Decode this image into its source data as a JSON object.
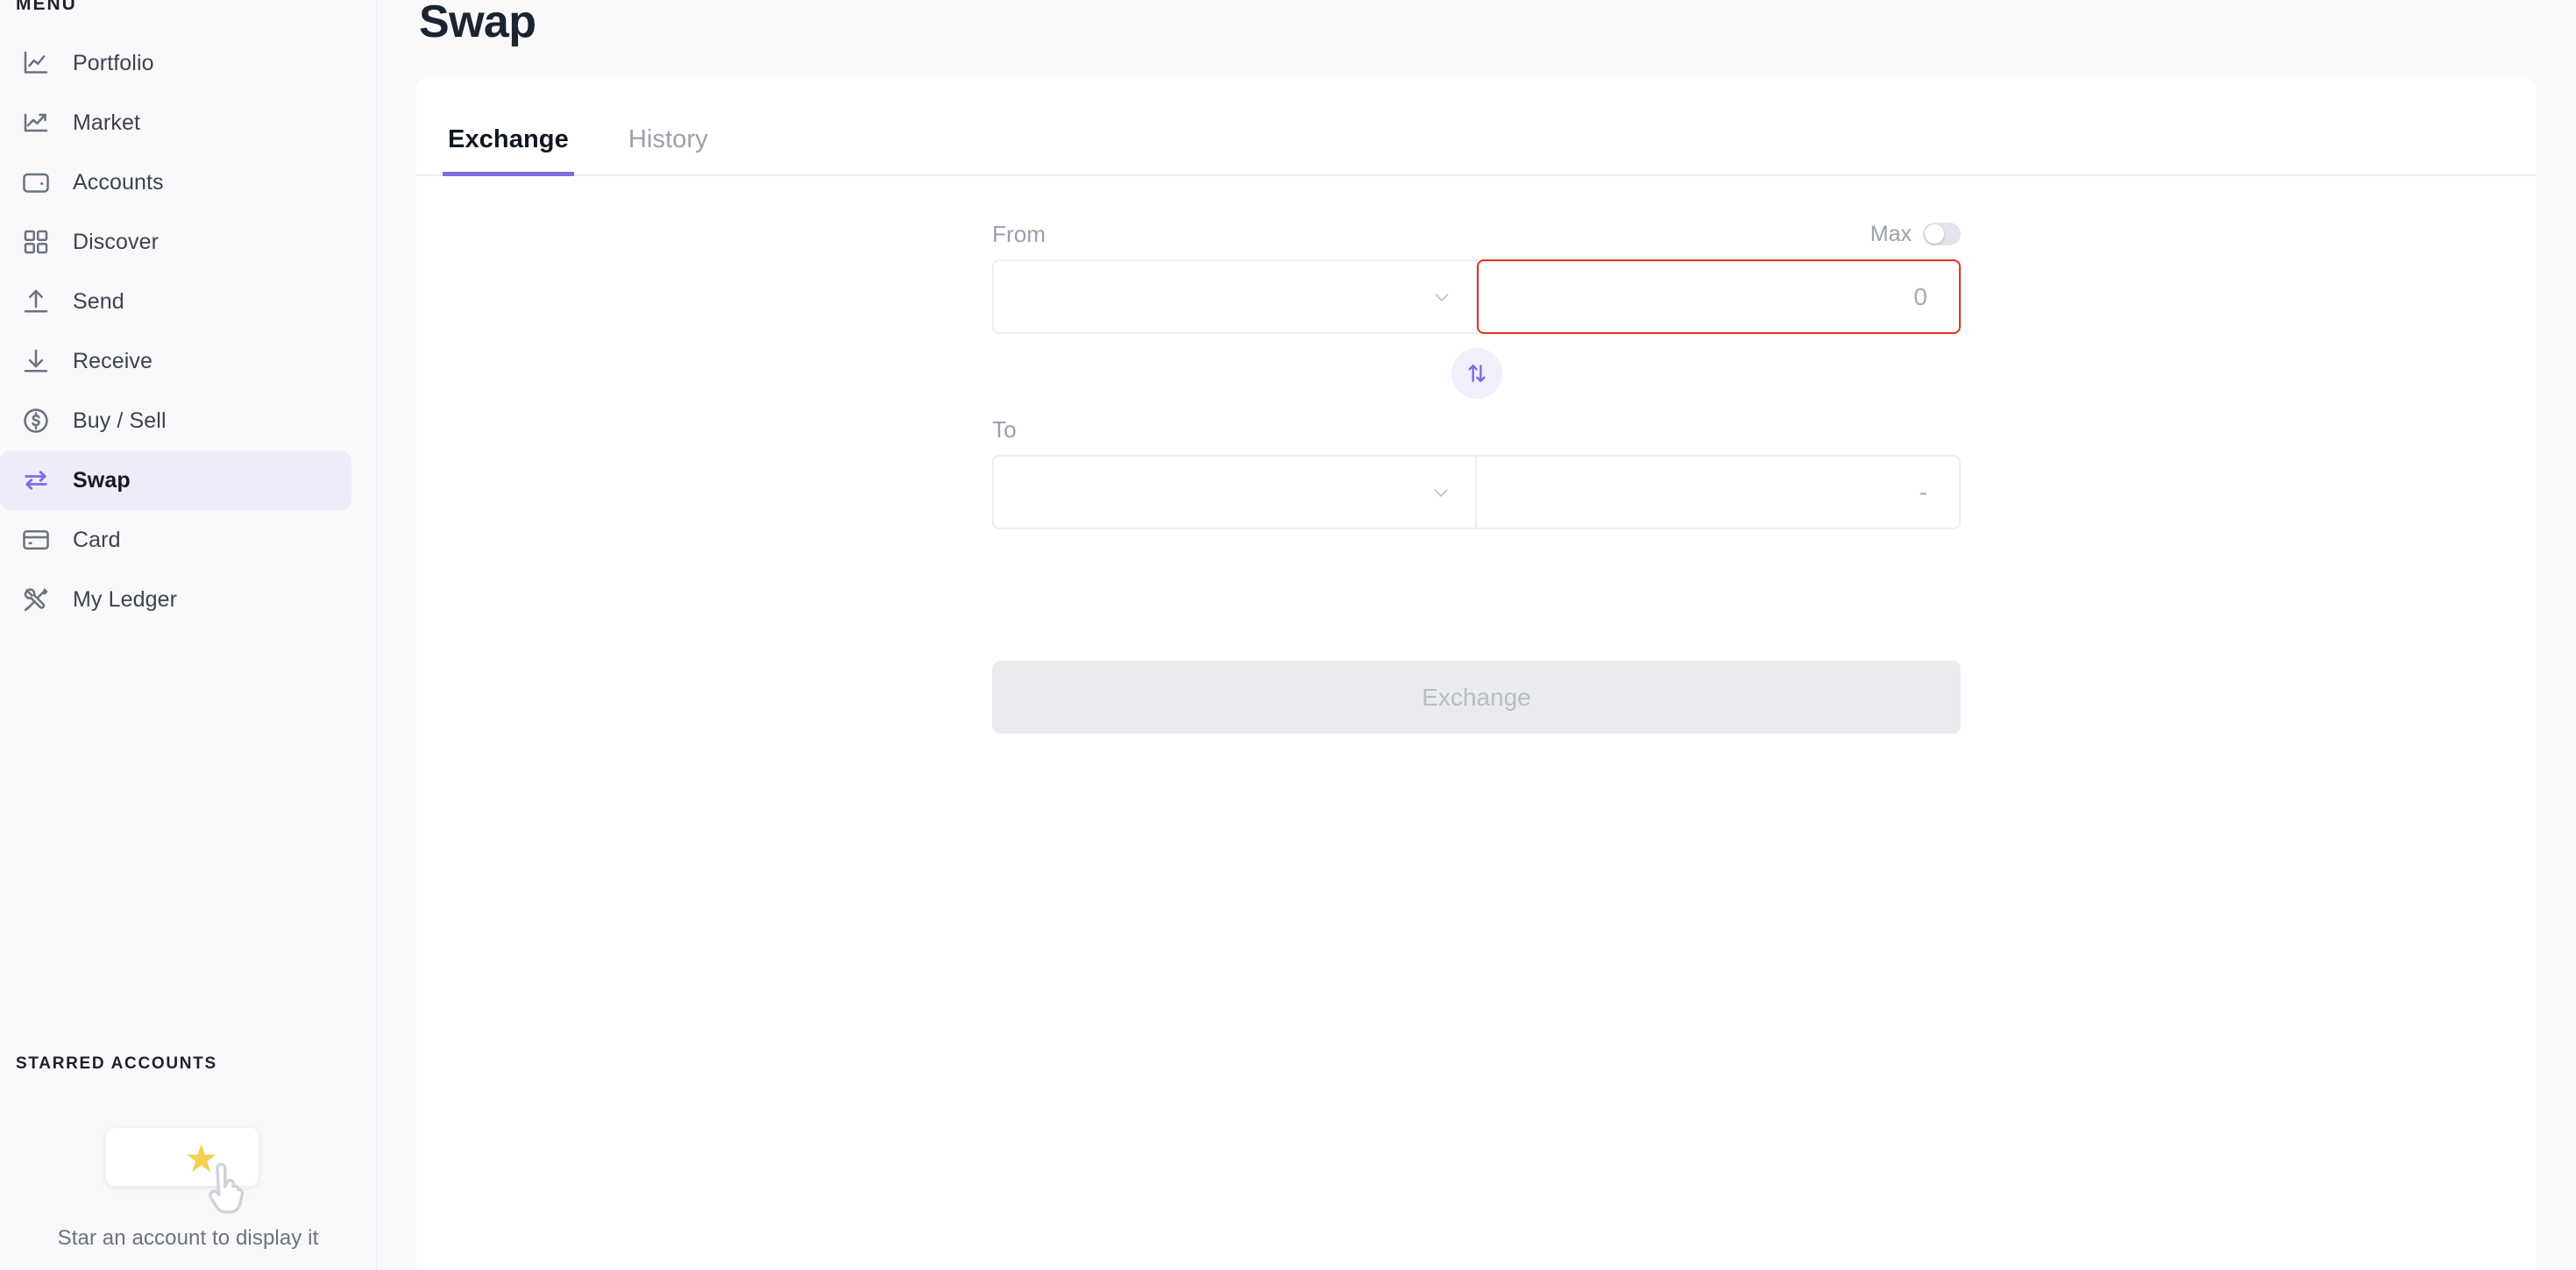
{
  "sidebar": {
    "menu_heading": "MENU",
    "items": [
      {
        "label": "Portfolio",
        "icon": "chart-line-icon",
        "active": false
      },
      {
        "label": "Market",
        "icon": "trending-up-icon",
        "active": false
      },
      {
        "label": "Accounts",
        "icon": "wallet-icon",
        "active": false
      },
      {
        "label": "Discover",
        "icon": "grid-icon",
        "active": false
      },
      {
        "label": "Send",
        "icon": "arrow-up-tray-icon",
        "active": false
      },
      {
        "label": "Receive",
        "icon": "arrow-down-tray-icon",
        "active": false
      },
      {
        "label": "Buy / Sell",
        "icon": "dollar-circle-icon",
        "active": false
      },
      {
        "label": "Swap",
        "icon": "swap-arrows-icon",
        "active": true
      },
      {
        "label": "Card",
        "icon": "credit-card-icon",
        "active": false
      },
      {
        "label": "My Ledger",
        "icon": "tools-icon",
        "active": false
      }
    ],
    "starred": {
      "heading": "STARRED ACCOUNTS",
      "empty_text": "Star an account to display it",
      "star_icon": "star-icon",
      "cursor_icon": "pointing-hand-cursor-icon"
    }
  },
  "main": {
    "page_title": "Swap",
    "tabs": [
      {
        "label": "Exchange",
        "active": true
      },
      {
        "label": "History",
        "active": false
      }
    ],
    "form": {
      "from": {
        "label": "From",
        "max_label": "Max",
        "max_enabled": false,
        "currency_placeholder": "",
        "amount_value": "0",
        "has_error": true
      },
      "swap_button_icon": "swap-vertical-icon",
      "to": {
        "label": "To",
        "currency_placeholder": "",
        "amount_value": "-"
      },
      "submit_label": "Exchange",
      "submit_disabled": true
    }
  },
  "colors": {
    "accent_purple": "#7e6ce4",
    "active_bg": "#eeecfa",
    "error_red": "#ea2e21",
    "star_yellow": "#f5cf52",
    "page_bg": "#f9f9fb",
    "card_bg": "#ffffff"
  }
}
